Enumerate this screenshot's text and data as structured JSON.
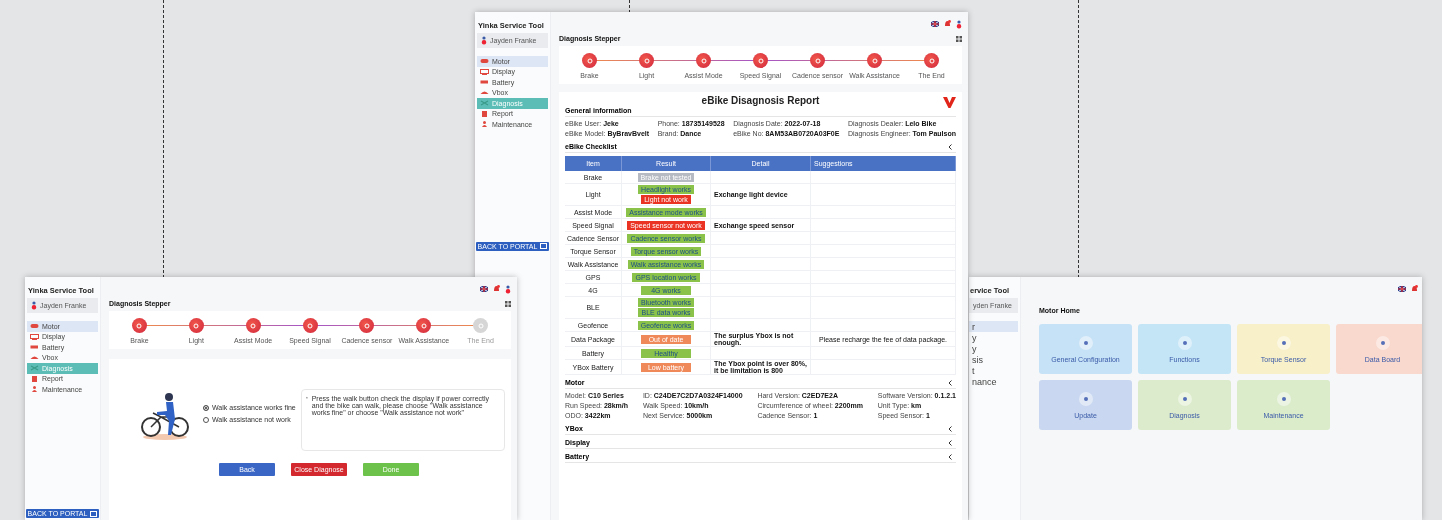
{
  "motor_home_window": {
    "app_title": "ervice Tool",
    "user_name": "yden Franke",
    "menu": [
      {
        "label": "r",
        "hovered": true,
        "selected": false
      },
      {
        "label": "y",
        "hovered": false,
        "selected": false
      },
      {
        "label": "y",
        "hovered": false,
        "selected": false
      },
      {
        "label": "sis",
        "hovered": false,
        "selected": false
      },
      {
        "label": "t",
        "hovered": false,
        "selected": false
      },
      {
        "label": "nance",
        "hovered": false,
        "selected": false
      }
    ],
    "page_title": "Motor Home",
    "tiles": [
      {
        "label": "General Configuration",
        "color": "#c6e2f6"
      },
      {
        "label": "Functions",
        "color": "#c4e5f6"
      },
      {
        "label": "Torque Sensor",
        "color": "#f8f0c8"
      },
      {
        "label": "Data Board",
        "color": "#f9d8cd"
      },
      {
        "label": "Update",
        "color": "#c9d8f0"
      },
      {
        "label": "Diagnosis",
        "color": "#dcebcb"
      },
      {
        "label": "Maintenance",
        "color": "#dbeccb"
      }
    ]
  },
  "report_window": {
    "app_title": "Yinka Service Tool",
    "user_name": "Jayden Franke",
    "menu": [
      {
        "label": "Motor",
        "hovered": true,
        "selected": false
      },
      {
        "label": "Display",
        "hovered": false,
        "selected": false
      },
      {
        "label": "Battery",
        "hovered": false,
        "selected": false
      },
      {
        "label": "Vbox",
        "hovered": false,
        "selected": false
      },
      {
        "label": "Diagnosis",
        "hovered": false,
        "selected": true
      },
      {
        "label": "Report",
        "hovered": false,
        "selected": false
      },
      {
        "label": "Maintenance",
        "hovered": false,
        "selected": false
      }
    ],
    "back_button": "BACK TO PORTAL",
    "page_title": "Diagnosis Stepper",
    "steps": [
      {
        "label": "Brake",
        "done": true
      },
      {
        "label": "Light",
        "done": true
      },
      {
        "label": "Assist Mode",
        "done": true
      },
      {
        "label": "Speed Signal",
        "done": true
      },
      {
        "label": "Cadence sensor",
        "done": true
      },
      {
        "label": "Walk Assistance",
        "done": true
      },
      {
        "label": "The End",
        "done": true
      }
    ],
    "report": {
      "title": "eBike Disagnosis Report",
      "general_heading": "General information",
      "general_info": [
        {
          "label": "eBike User:",
          "value": "Jeke"
        },
        {
          "label": "Phone:",
          "value": "18735149528"
        },
        {
          "label": "Diagnosis Date:",
          "value": "2022-07-18"
        },
        {
          "label": "Diagnosis Dealer:",
          "value": "Lelo Bike"
        },
        {
          "label": "eBike Model:",
          "value": "ByBravBvelt"
        },
        {
          "label": "Brand:",
          "value": "Dance"
        },
        {
          "label": "eBike No:",
          "value": "8AM53AB0720A03F0E"
        },
        {
          "label": "Diagnosis Engineer:",
          "value": "Tom Paulson"
        }
      ],
      "checklist_heading": "eBike Checklist",
      "columns": [
        "Item",
        "Result",
        "Detail",
        "Suggestions"
      ],
      "rows": [
        {
          "item": "Brake",
          "results": [
            {
              "text": "Brake not tested",
              "kind": "none"
            }
          ]
        },
        {
          "item": "Light",
          "results": [
            {
              "text": "Headlight works",
              "kind": "ok"
            },
            {
              "text": "Light not work",
              "kind": "fail"
            }
          ],
          "detail": "Exchange light device"
        },
        {
          "item": "Assist Mode",
          "results": [
            {
              "text": "Assistance mode works",
              "kind": "ok"
            }
          ]
        },
        {
          "item": "Speed Signal",
          "results": [
            {
              "text": "Speed sensor not work",
              "kind": "fail"
            }
          ],
          "detail": "Exchange speed sensor"
        },
        {
          "item": "Cadence Sensor",
          "results": [
            {
              "text": "Cadence sensor works",
              "kind": "ok"
            }
          ]
        },
        {
          "item": "Torque Sensor",
          "results": [
            {
              "text": "Torque sensor works",
              "kind": "ok"
            }
          ]
        },
        {
          "item": "Walk Assistance",
          "results": [
            {
              "text": "Walk assistance works",
              "kind": "ok"
            }
          ]
        },
        {
          "item": "GPS",
          "results": [
            {
              "text": "GPS location works",
              "kind": "ok"
            }
          ]
        },
        {
          "item": "4G",
          "results": [
            {
              "text": "4G works",
              "kind": "ok"
            }
          ]
        },
        {
          "item": "BLE",
          "results": [
            {
              "text": "Bluetooth works",
              "kind": "ok"
            },
            {
              "text": "BLE data works",
              "kind": "ok"
            }
          ]
        },
        {
          "item": "Geofence",
          "results": [
            {
              "text": "Geofence works",
              "kind": "ok"
            }
          ]
        },
        {
          "item": "Data Package",
          "results": [
            {
              "text": "Out of date",
              "kind": "warn"
            }
          ],
          "detail": "The surplus Ybox is not enough.",
          "suggestion": "Please recharge the fee of data package."
        },
        {
          "item": "Battery",
          "results": [
            {
              "text": "Healthy",
              "kind": "ok"
            }
          ]
        },
        {
          "item": "YBox Battery",
          "results": [
            {
              "text": "Low battery",
              "kind": "warn"
            }
          ],
          "detail": "The Ybox point is over 80%, it be limitation is 800"
        }
      ],
      "motor_heading": "Motor",
      "motor_info": [
        {
          "label": "Model:",
          "value": "C10 Series"
        },
        {
          "label": "ID:",
          "value": "C24DE7C2D7A0324F14000"
        },
        {
          "label": "Hard Version:",
          "value": "C2ED7E2A"
        },
        {
          "label": "Software Version:",
          "value": "0.1.2.1"
        },
        {
          "label": "Run Speed:",
          "value": "28km/h"
        },
        {
          "label": "Walk Speed:",
          "value": "10km/h"
        },
        {
          "label": "Circumference of wheel:",
          "value": "2200mm"
        },
        {
          "label": "Unit Type:",
          "value": "km"
        },
        {
          "label": "ODO:",
          "value": "3422km"
        },
        {
          "label": "Next Service:",
          "value": "5000km"
        },
        {
          "label": "Cadence Sensor:",
          "value": "1"
        },
        {
          "label": "Speed Sensor:",
          "value": "1"
        }
      ],
      "collapsed_sections": [
        "YBox",
        "Display",
        "Battery"
      ]
    }
  },
  "stepper_window": {
    "app_title": "Yinka Service Tool",
    "user_name": "Jayden Franke",
    "menu": [
      {
        "label": "Motor",
        "hovered": true,
        "selected": false
      },
      {
        "label": "Display",
        "hovered": false,
        "selected": false
      },
      {
        "label": "Battery",
        "hovered": false,
        "selected": false
      },
      {
        "label": "Vbox",
        "hovered": false,
        "selected": false
      },
      {
        "label": "Diagnosis",
        "hovered": false,
        "selected": true
      },
      {
        "label": "Report",
        "hovered": false,
        "selected": false
      },
      {
        "label": "Maintenance",
        "hovered": false,
        "selected": false
      }
    ],
    "back_button": "BACK TO PORTAL",
    "page_title": "Diagnosis Stepper",
    "steps": [
      {
        "label": "Brake",
        "done": true
      },
      {
        "label": "Light",
        "done": true
      },
      {
        "label": "Assist Mode",
        "done": true
      },
      {
        "label": "Speed Signal",
        "done": true
      },
      {
        "label": "Cadence sensor",
        "done": true
      },
      {
        "label": "Walk Assistance",
        "done": true
      },
      {
        "label": "The End",
        "done": false
      }
    ],
    "options": [
      {
        "label": "Walk assistance works fine",
        "selected": true
      },
      {
        "label": "Walk assistance not work",
        "selected": false
      }
    ],
    "hint": "Press the walk button check the display if power correctly and the bike can walk, please choose \"Walk assistance works fine\" or choose \"Walk assistance not work\"",
    "buttons": [
      {
        "label": "Back",
        "kind": "primary"
      },
      {
        "label": "Close Diagnose",
        "kind": "danger"
      },
      {
        "label": "Done",
        "kind": "success"
      }
    ]
  }
}
